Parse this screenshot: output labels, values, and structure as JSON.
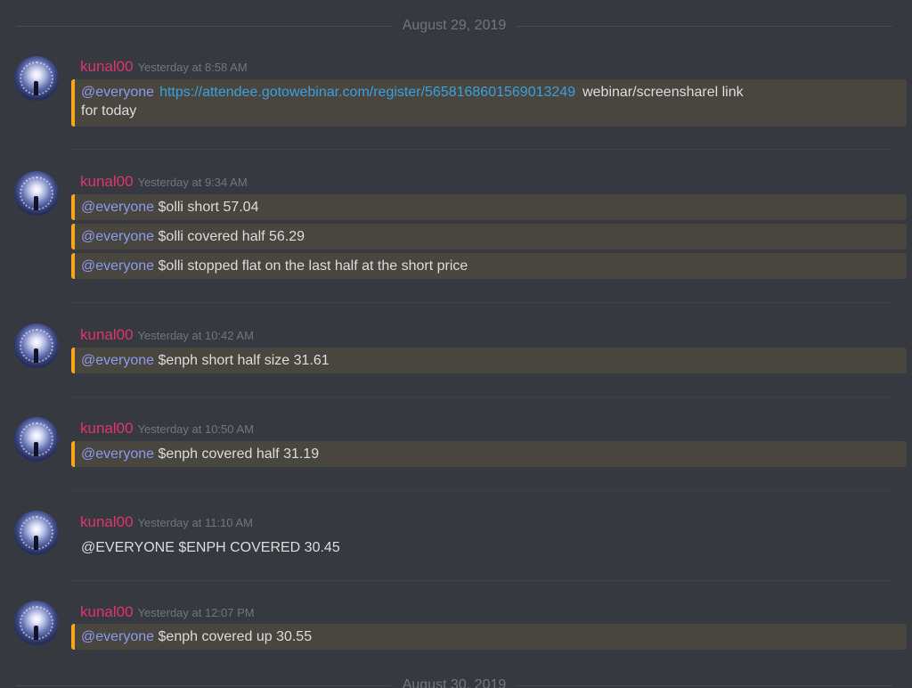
{
  "dividers": {
    "top": "August 29, 2019",
    "bottom": "August 30, 2019"
  },
  "author": "kunal00",
  "messages": [
    {
      "time": "Yesterday at 8:58 AM",
      "lines": [
        {
          "mention": "@everyone",
          "link": "https://attendee.gotowebinar.com/register/5658168601569013249",
          "text": "webinar/screensharel link",
          "text2": "for today"
        }
      ]
    },
    {
      "time": "Yesterday at 9:34 AM",
      "lines": [
        {
          "mention": "@everyone",
          "text": "$olli short 57.04"
        },
        {
          "mention": "@everyone",
          "text": "$olli covered half 56.29"
        },
        {
          "mention": "@everyone",
          "text": "$olli stopped flat on the last half at the short price"
        }
      ]
    },
    {
      "time": "Yesterday at 10:42 AM",
      "lines": [
        {
          "mention": "@everyone",
          "text": "$enph short half size 31.61"
        }
      ]
    },
    {
      "time": "Yesterday at 10:50 AM",
      "lines": [
        {
          "mention": "@everyone",
          "text": "$enph covered half 31.19"
        }
      ]
    },
    {
      "time": "Yesterday at 11:10 AM",
      "lines": [
        {
          "text": "@EVERYONE $ENPH COVERED 30.45"
        }
      ]
    },
    {
      "time": "Yesterday at 12:07 PM",
      "lines": [
        {
          "mention": "@everyone",
          "text": "$enph covered up 30.55"
        }
      ]
    }
  ],
  "colors": {
    "background": "#36393f",
    "username": "#e0356c",
    "mention": "#8a9bef",
    "link": "#3aa0df",
    "highlight_bar": "#faa61a",
    "highlight_bg": "#49463f"
  }
}
